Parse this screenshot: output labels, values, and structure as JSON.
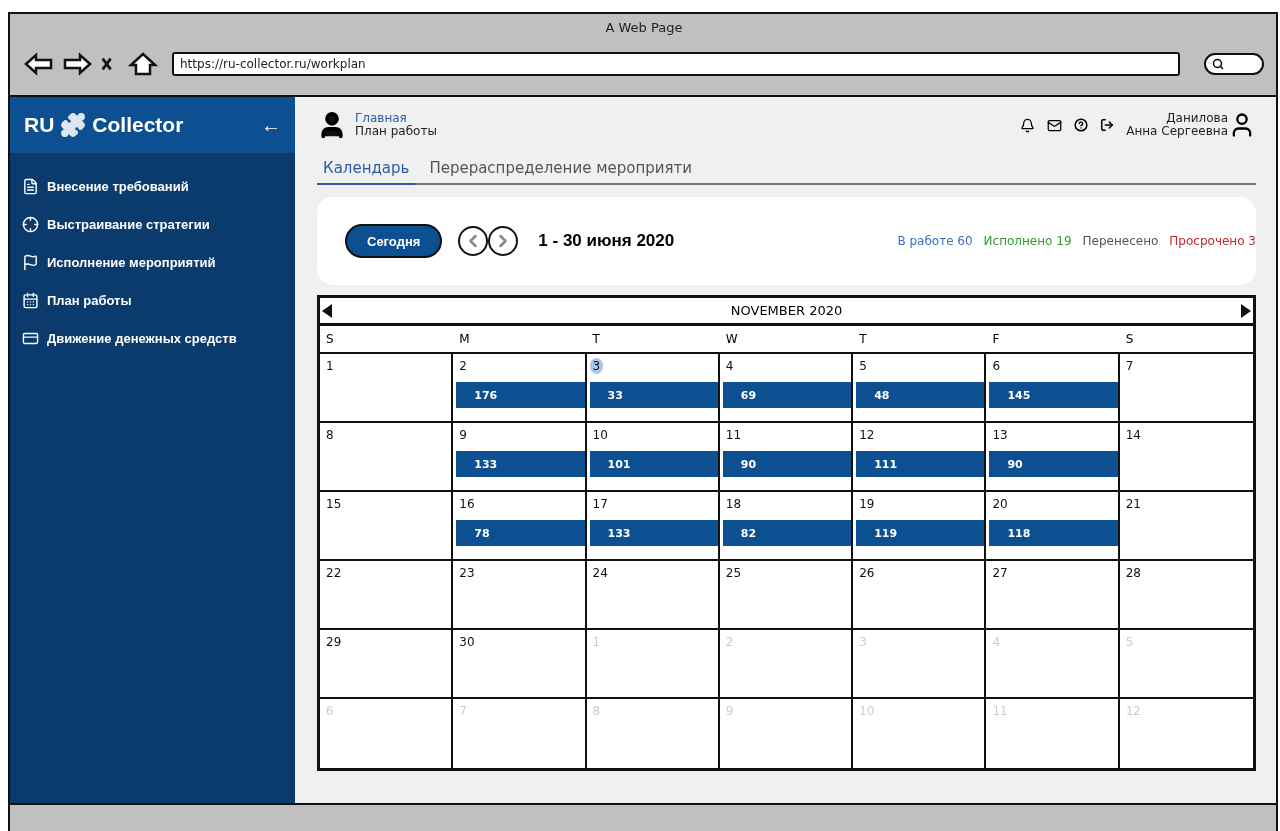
{
  "browser": {
    "title": "A Web Page",
    "url": "https://ru-collector.ru/workplan"
  },
  "sidebar": {
    "logo_left": "RU",
    "logo_right": "Collector",
    "collapse": "←",
    "items": [
      {
        "label": "Внесение требований",
        "selected": false
      },
      {
        "label": "Выстраивание стратегии",
        "selected": false
      },
      {
        "label": "Исполнение мероприятий",
        "selected": false
      },
      {
        "label": "План работы",
        "selected": false
      },
      {
        "label": "Движение денежных средств",
        "selected": false
      }
    ]
  },
  "header": {
    "breadcrumb_link": "Главная",
    "breadcrumb_current": "План работы",
    "user_last_name": "Данилова",
    "user_first_names": "Анна Сергеевна"
  },
  "tabs": [
    {
      "label": "Календарь",
      "selected": true
    },
    {
      "label": "Перераспределение мероприяти",
      "selected": false
    }
  ],
  "toolbar": {
    "today_button": "Сегодня",
    "period": "1 - 30 июня 2020",
    "stats": [
      {
        "label": "В работе 60",
        "color": "#3a6fc4"
      },
      {
        "label": "Исполнено 19",
        "color": "#2e9e2e"
      },
      {
        "label": "Перенесено",
        "color": "#555555"
      },
      {
        "label": "Просрочено 3",
        "color": "#c0282d"
      }
    ]
  },
  "calendar": {
    "month": "NOVEMBER 2020",
    "weekdays": [
      "S",
      "M",
      "T",
      "W",
      "T",
      "F",
      "S"
    ],
    "weeks": [
      [
        {
          "day": "1",
          "in_month": true,
          "selected": false
        },
        {
          "day": "2",
          "in_month": true,
          "selected": false,
          "count": "176"
        },
        {
          "day": "3",
          "in_month": true,
          "selected": true,
          "count": "33"
        },
        {
          "day": "4",
          "in_month": true,
          "selected": false,
          "count": "69"
        },
        {
          "day": "5",
          "in_month": true,
          "selected": false,
          "count": "48"
        },
        {
          "day": "6",
          "in_month": true,
          "selected": false,
          "count": "145"
        },
        {
          "day": "7",
          "in_month": true,
          "selected": false
        }
      ],
      [
        {
          "day": "8",
          "in_month": true,
          "selected": false
        },
        {
          "day": "9",
          "in_month": true,
          "selected": false,
          "count": "133"
        },
        {
          "day": "10",
          "in_month": true,
          "selected": false,
          "count": "101"
        },
        {
          "day": "11",
          "in_month": true,
          "selected": false,
          "count": "90"
        },
        {
          "day": "12",
          "in_month": true,
          "selected": false,
          "count": "111"
        },
        {
          "day": "13",
          "in_month": true,
          "selected": false,
          "count": "90"
        },
        {
          "day": "14",
          "in_month": true,
          "selected": false
        }
      ],
      [
        {
          "day": "15",
          "in_month": true,
          "selected": false
        },
        {
          "day": "16",
          "in_month": true,
          "selected": false,
          "count": "78"
        },
        {
          "day": "17",
          "in_month": true,
          "selected": false,
          "count": "133"
        },
        {
          "day": "18",
          "in_month": true,
          "selected": false,
          "count": "82"
        },
        {
          "day": "19",
          "in_month": true,
          "selected": false,
          "count": "119"
        },
        {
          "day": "20",
          "in_month": true,
          "selected": false,
          "count": "118"
        },
        {
          "day": "21",
          "in_month": true,
          "selected": false
        }
      ],
      [
        {
          "day": "22",
          "in_month": true,
          "selected": false
        },
        {
          "day": "23",
          "in_month": true,
          "selected": false
        },
        {
          "day": "24",
          "in_month": true,
          "selected": false
        },
        {
          "day": "25",
          "in_month": true,
          "selected": false
        },
        {
          "day": "26",
          "in_month": true,
          "selected": false
        },
        {
          "day": "27",
          "in_month": true,
          "selected": false
        },
        {
          "day": "28",
          "in_month": true,
          "selected": false
        }
      ],
      [
        {
          "day": "29",
          "in_month": true,
          "selected": false
        },
        {
          "day": "30",
          "in_month": true,
          "selected": false
        },
        {
          "day": "1",
          "in_month": false,
          "selected": false
        },
        {
          "day": "2",
          "in_month": false,
          "selected": false
        },
        {
          "day": "3",
          "in_month": false,
          "selected": false
        },
        {
          "day": "4",
          "in_month": false,
          "selected": false
        },
        {
          "day": "5",
          "in_month": false,
          "selected": false
        }
      ],
      [
        {
          "day": "6",
          "in_month": false,
          "selected": false
        },
        {
          "day": "7",
          "in_month": false,
          "selected": false
        },
        {
          "day": "8",
          "in_month": false,
          "selected": false
        },
        {
          "day": "9",
          "in_month": false,
          "selected": false
        },
        {
          "day": "10",
          "in_month": false,
          "selected": false
        },
        {
          "day": "11",
          "in_month": false,
          "selected": false
        },
        {
          "day": "12",
          "in_month": false,
          "selected": false
        }
      ]
    ]
  }
}
